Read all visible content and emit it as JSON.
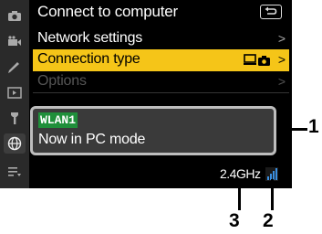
{
  "header": {
    "title": "Connect to computer"
  },
  "menu": {
    "items": [
      {
        "label": "Network settings",
        "chevron": ">",
        "state": "normal"
      },
      {
        "label": "Connection type",
        "chevron": ">",
        "state": "selected"
      },
      {
        "label": "Options",
        "chevron": ">",
        "state": "disabled"
      }
    ]
  },
  "status": {
    "network_name": "WLAN1",
    "message": "Now in PC mode"
  },
  "footer": {
    "frequency": "2.4GHz",
    "signal_icon": "signal-strength-icon"
  },
  "callouts": {
    "one": "1",
    "two": "2",
    "three": "3"
  },
  "colors": {
    "selected": "#f5c518",
    "wlan_badge": "#1f8f3a",
    "signal": "#3a8fe0"
  }
}
